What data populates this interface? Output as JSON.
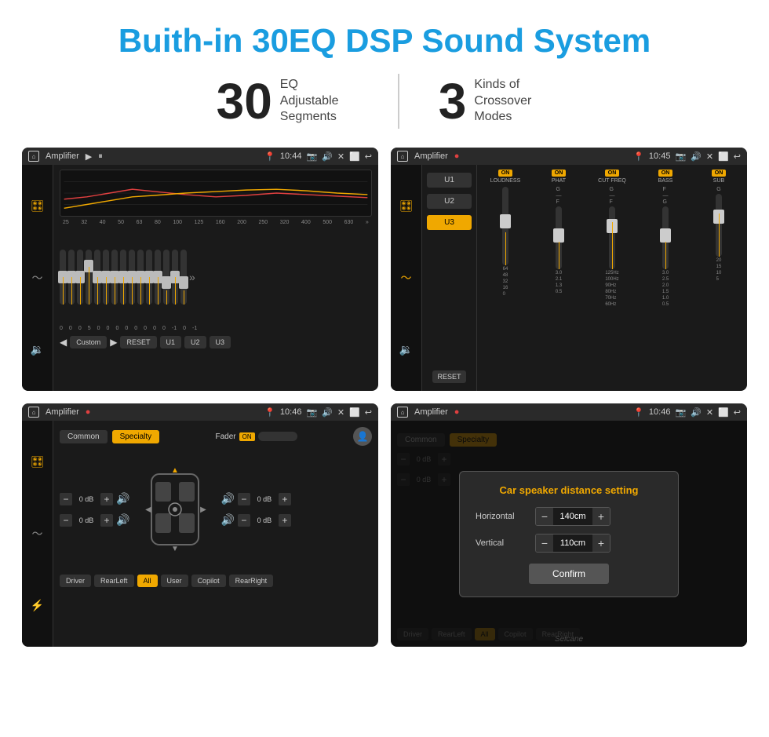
{
  "page": {
    "title": "Buith-in 30EQ DSP Sound System",
    "stat1_number": "30",
    "stat1_desc": "EQ Adjustable\nSegments",
    "stat2_number": "3",
    "stat2_desc": "Kinds of\nCrossover Modes"
  },
  "screen_tl": {
    "title": "Amplifier",
    "time": "10:44",
    "freq_labels": [
      "25",
      "32",
      "40",
      "50",
      "63",
      "80",
      "100",
      "125",
      "160",
      "200",
      "250",
      "320",
      "400",
      "500",
      "630"
    ],
    "eq_values": [
      "0",
      "0",
      "0",
      "5",
      "0",
      "0",
      "0",
      "0",
      "0",
      "0",
      "0",
      "0",
      "-1",
      "0",
      "-1"
    ],
    "buttons": [
      "Custom",
      "RESET",
      "U1",
      "U2",
      "U3"
    ]
  },
  "screen_tr": {
    "title": "Amplifier",
    "time": "10:45",
    "presets": [
      "U1",
      "U2",
      "U3"
    ],
    "active_preset": "U3",
    "channels": [
      {
        "label": "LOUDNESS",
        "on": true
      },
      {
        "label": "PHAT",
        "on": true
      },
      {
        "label": "CUT FREQ",
        "on": true
      },
      {
        "label": "BASS",
        "on": true
      },
      {
        "label": "SUB",
        "on": true
      }
    ],
    "reset_label": "RESET"
  },
  "screen_bl": {
    "title": "Amplifier",
    "time": "10:46",
    "tabs": [
      "Common",
      "Specialty"
    ],
    "active_tab": "Specialty",
    "fader_label": "Fader",
    "fader_on": "ON",
    "db_controls": [
      {
        "label": "Driver",
        "value": "0 dB"
      },
      {
        "label": "RearLeft",
        "value": "0 dB"
      },
      {
        "label": "Copilot",
        "value": "0 dB"
      },
      {
        "label": "RearRight",
        "value": "0 dB"
      }
    ],
    "position_btns": [
      "Driver",
      "RearLeft",
      "All",
      "User",
      "Copilot",
      "RearRight"
    ],
    "active_pos": "All"
  },
  "screen_br": {
    "title": "Amplifier",
    "time": "10:46",
    "dialog": {
      "title": "Car speaker distance setting",
      "horizontal_label": "Horizontal",
      "horizontal_value": "140cm",
      "vertical_label": "Vertical",
      "vertical_value": "110cm",
      "confirm_label": "Confirm"
    }
  },
  "watermark": "Seicane"
}
